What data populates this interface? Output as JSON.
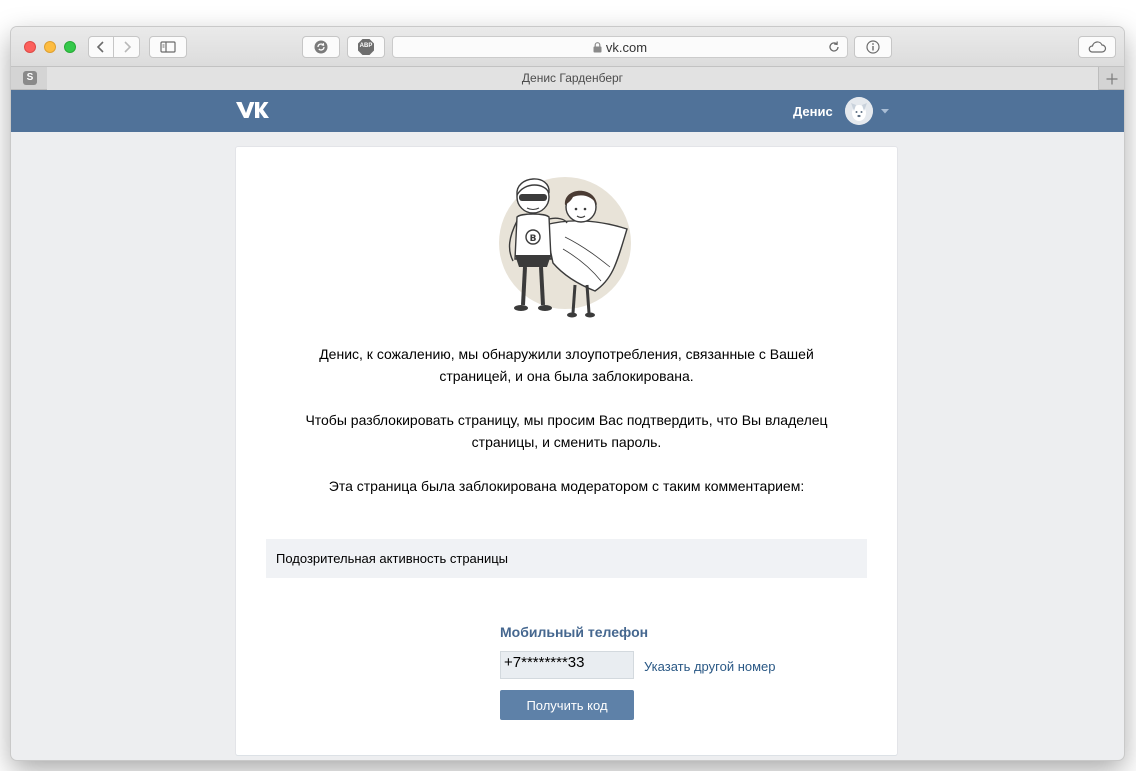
{
  "browser": {
    "url": "vk.com",
    "tab_title": "Денис Гарденберг",
    "pinned_tab_letter": "S",
    "adblock_label": "ABP"
  },
  "header": {
    "logo": "VK",
    "username": "Денис"
  },
  "main": {
    "paragraph1": "Денис, к сожалению, мы обнаружили злоупотребления, связанные с Вашей страницей, и она была заблокирована.",
    "paragraph2": "Чтобы разблокировать страницу, мы просим Вас подтвердить, что Вы владелец страницы, и сменить пароль.",
    "paragraph3": "Эта страница была заблокирована модератором с таким комментарием:",
    "comment": "Подозрительная активность страницы",
    "phone_label": "Мобильный телефон",
    "phone_value": "+7********33",
    "other_number_link": "Указать другой номер",
    "get_code_button": "Получить код"
  },
  "colors": {
    "header_bg": "#507299",
    "button_bg": "#5e81a8",
    "link": "#2a5885",
    "label": "#45678f"
  }
}
